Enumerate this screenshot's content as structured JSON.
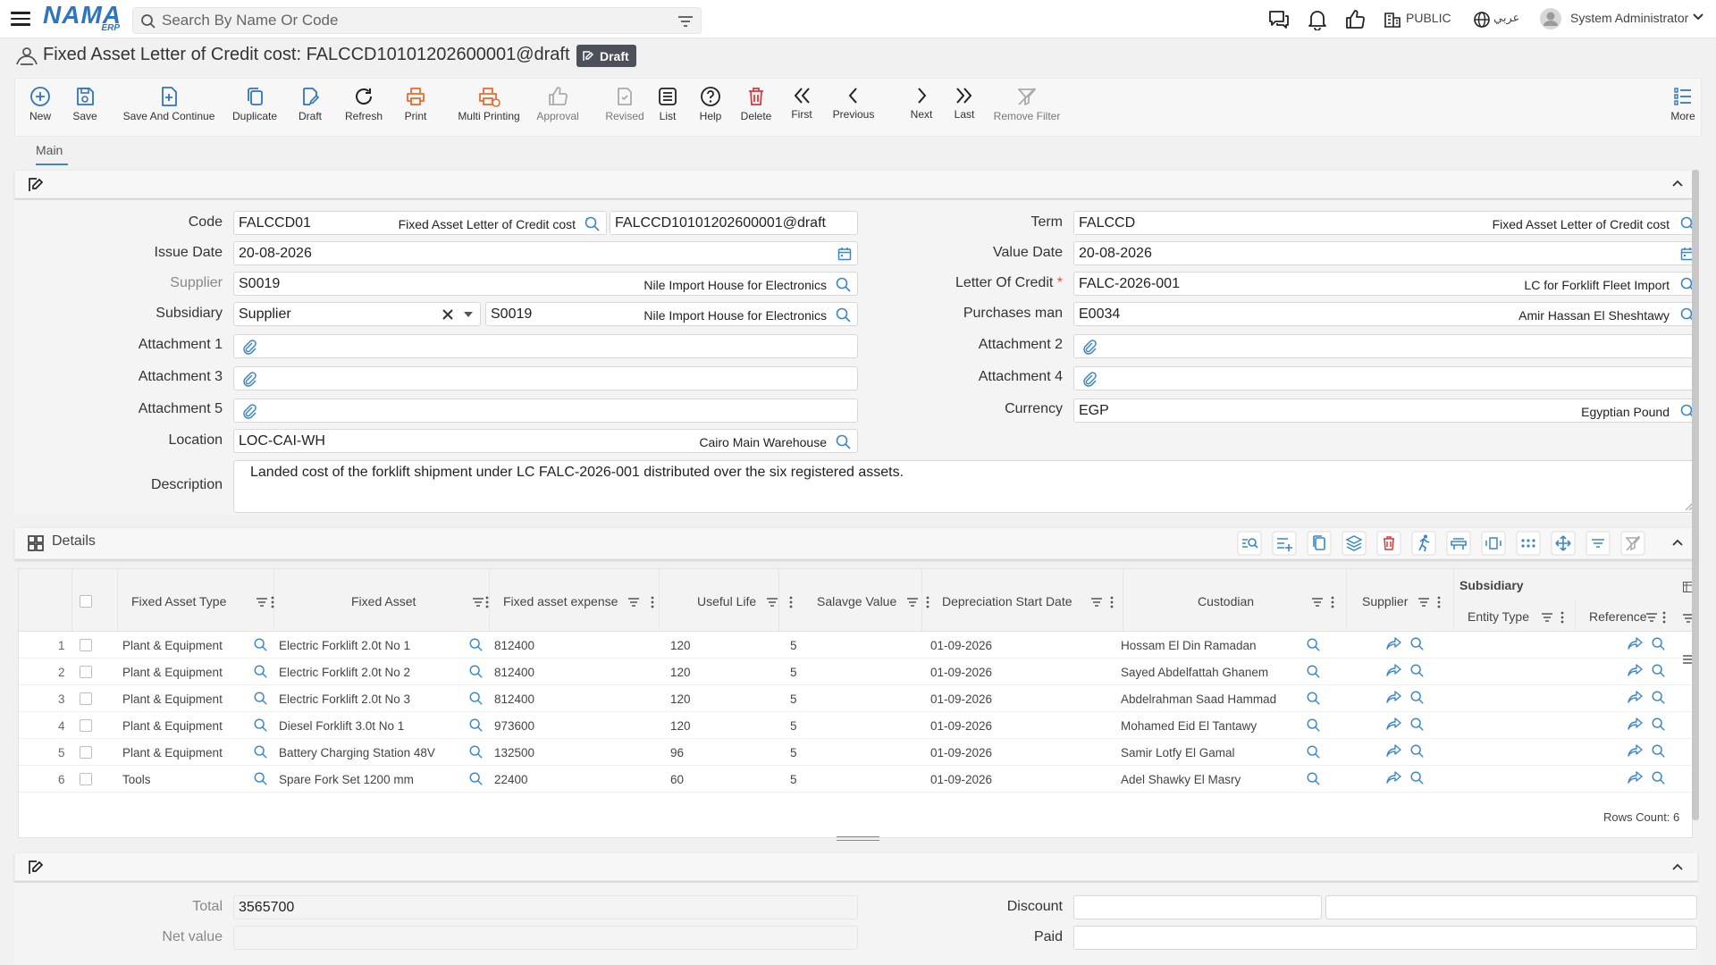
{
  "header": {
    "logo": "NAMA",
    "logo_sub": "ERP",
    "search_placeholder": "Search By Name Or Code",
    "public_label": "PUBLIC",
    "language_label": "عربي",
    "user_name": "System Administrator"
  },
  "page": {
    "title": "Fixed Asset Letter of Credit cost: FALCCD10101202600001@draft",
    "status": "Draft"
  },
  "toolbar": [
    {
      "label": "New",
      "icon": "plus-circle-icon",
      "color": "#2f74c0"
    },
    {
      "label": "Save",
      "icon": "save-icon",
      "color": "#2f74c0"
    },
    {
      "label": "Save And Continue",
      "icon": "save-continue-icon",
      "color": "#2f74c0"
    },
    {
      "label": "Duplicate",
      "icon": "duplicate-icon",
      "color": "#2f74c0"
    },
    {
      "label": "Draft",
      "icon": "draft-icon",
      "color": "#2f74c0"
    },
    {
      "label": "Refresh",
      "icon": "refresh-icon",
      "color": "#222222"
    },
    {
      "label": "Print",
      "icon": "print-icon",
      "color": "#e86a2c"
    },
    {
      "label": "Multi Printing",
      "icon": "multi-print-icon",
      "color": "#e86a2c"
    },
    {
      "label": "Approval",
      "icon": "thumbs-up-icon",
      "color": "#aaaaaa"
    },
    {
      "label": "Revised",
      "icon": "revised-icon",
      "color": "#aaaaaa"
    },
    {
      "label": "List",
      "icon": "list-icon",
      "color": "#222222"
    },
    {
      "label": "Help",
      "icon": "help-icon",
      "color": "#222222"
    },
    {
      "label": "Delete",
      "icon": "trash-icon",
      "color": "#d93b3b"
    },
    {
      "label": "First",
      "icon": "first-icon",
      "color": "#222222"
    },
    {
      "label": "Previous",
      "icon": "previous-icon",
      "color": "#222222"
    },
    {
      "label": "Next",
      "icon": "next-icon",
      "color": "#222222"
    },
    {
      "label": "Last",
      "icon": "last-icon",
      "color": "#222222"
    },
    {
      "label": "Remove Filter",
      "icon": "remove-filter-icon",
      "color": "#aaaaaa"
    },
    {
      "label": "More",
      "icon": "more-icon",
      "color": "#2f74c0"
    }
  ],
  "tabs": {
    "main": "Main"
  },
  "form": {
    "code_label": "Code",
    "code_value": "FALCCD01",
    "code_desc": "Fixed Asset Letter of Credit cost",
    "code_doc": "FALCCD10101202600001@draft",
    "issue_date_label": "Issue Date",
    "issue_date": "20-08-2026",
    "supplier_label": "Supplier",
    "supplier_code": "S0019",
    "supplier_name": "Nile Import House for Electronics",
    "subsidiary_label": "Subsidiary",
    "subsidiary_type": "Supplier",
    "subsidiary_code": "S0019",
    "subsidiary_name": "Nile Import House for Electronics",
    "attachment1_label": "Attachment 1",
    "attachment3_label": "Attachment 3",
    "attachment5_label": "Attachment 5",
    "location_label": "Location",
    "location_code": "LOC-CAI-WH",
    "location_name": "Cairo Main Warehouse",
    "description_label": "Description",
    "description": "Landed cost of the forklift shipment under LC FALC-2026-001 distributed over the six registered assets.",
    "term_label": "Term",
    "term_code": "FALCCD",
    "term_desc": "Fixed Asset Letter of Credit cost",
    "value_date_label": "Value Date",
    "value_date": "20-08-2026",
    "loc_label": "Letter Of Credit",
    "loc_code": "FALC-2026-001",
    "loc_name": "LC for Forklift Fleet Import",
    "purchases_man_label": "Purchases man",
    "purchases_man_code": "E0034",
    "purchases_man_name": "Amir Hassan El Sheshtawy",
    "attachment2_label": "Attachment 2",
    "attachment4_label": "Attachment 4",
    "currency_label": "Currency",
    "currency_code": "EGP",
    "currency_name": "Egyptian Pound"
  },
  "details": {
    "title": "Details",
    "columns": [
      "Fixed Asset Type",
      "Fixed Asset",
      "Fixed asset expense",
      "Useful Life",
      "Salavge Value",
      "Depreciation Start Date",
      "Custodian",
      "Supplier",
      "Subsidiary",
      "Entity Type",
      "Reference"
    ],
    "rows": [
      {
        "n": "1",
        "type": "Plant & Equipment",
        "asset": "Electric Forklift 2.0t No 1",
        "expense": "812400",
        "life": "120",
        "salvage": "5",
        "start": "01-09-2026",
        "custodian": "Hossam El Din Ramadan"
      },
      {
        "n": "2",
        "type": "Plant & Equipment",
        "asset": "Electric Forklift 2.0t No 2",
        "expense": "812400",
        "life": "120",
        "salvage": "5",
        "start": "01-09-2026",
        "custodian": "Sayed Abdelfattah Ghanem"
      },
      {
        "n": "3",
        "type": "Plant & Equipment",
        "asset": "Electric Forklift 2.0t No 3",
        "expense": "812400",
        "life": "120",
        "salvage": "5",
        "start": "01-09-2026",
        "custodian": "Abdelrahman Saad Hammad"
      },
      {
        "n": "4",
        "type": "Plant & Equipment",
        "asset": "Diesel Forklift 3.0t No 1",
        "expense": "973600",
        "life": "120",
        "salvage": "5",
        "start": "01-09-2026",
        "custodian": "Mohamed Eid El Tantawy"
      },
      {
        "n": "5",
        "type": "Plant & Equipment",
        "asset": "Battery Charging Station 48V",
        "expense": "132500",
        "life": "96",
        "salvage": "5",
        "start": "01-09-2026",
        "custodian": "Samir Lotfy El Gamal"
      },
      {
        "n": "6",
        "type": "Tools",
        "asset": "Spare Fork Set 1200 mm",
        "expense": "22400",
        "life": "60",
        "salvage": "5",
        "start": "01-09-2026",
        "custodian": "Adel Shawky El Masry"
      }
    ],
    "rows_count": "Rows Count: 6"
  },
  "totals": {
    "total_label": "Total",
    "total": "3565700",
    "net_value_label": "Net value",
    "net_value": "",
    "discount_label": "Discount",
    "paid_label": "Paid"
  }
}
